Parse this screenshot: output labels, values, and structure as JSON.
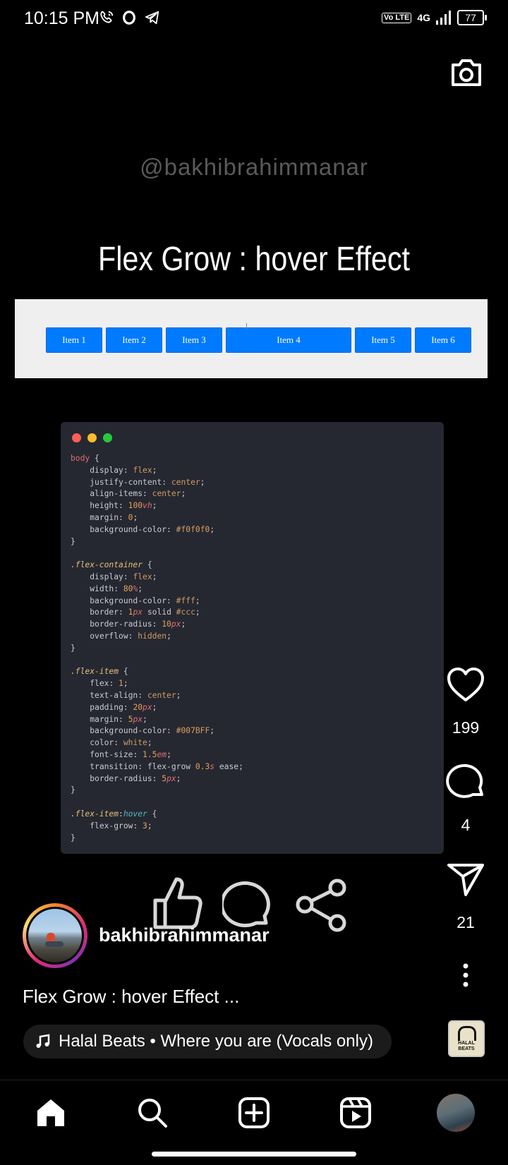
{
  "status_bar": {
    "time": "10:15 PM",
    "volte": "Vo LTE",
    "network": "4G",
    "battery": "77",
    "icons": [
      "call-icon",
      "opera-icon",
      "telegram-icon",
      "signal-icon",
      "battery-icon"
    ]
  },
  "post": {
    "watermark": "@bakhibrahimmanar",
    "title": "Flex Grow : hover Effect",
    "demo_items": [
      "Item 1",
      "Item 2",
      "Item 3",
      "Item 4",
      "Item 5",
      "Item 6"
    ],
    "code_lines": [
      "body {",
      "    display: flex;",
      "    justify-content: center;",
      "    align-items: center;",
      "    height: 100vh;",
      "    margin: 0;",
      "    background-color: #f0f0f0;",
      "}",
      "",
      ".flex-container {",
      "    display: flex;",
      "    width: 80%;",
      "    background-color: #fff;",
      "    border: 1px solid #ccc;",
      "    border-radius: 10px;",
      "    overflow: hidden;",
      "}",
      "",
      ".flex-item {",
      "    flex: 1;",
      "    text-align: center;",
      "    padding: 20px;",
      "    margin: 5px;",
      "    background-color: #007BFF;",
      "    color: white;",
      "    font-size: 1.5em;",
      "    transition: flex-grow 0.3s ease;",
      "    border-radius: 5px;",
      "}",
      "",
      ".flex-item:hover {",
      "    flex-grow: 3;",
      "}"
    ]
  },
  "actions": {
    "likes": "199",
    "comments": "4",
    "shares": "21"
  },
  "author": {
    "username": "bakhibrahimmanar",
    "caption": "Flex Grow : hover Effect ..."
  },
  "music": {
    "label": "Halal Beats • Where you are (Vocals only)",
    "thumb_text": "HALAL BEATS"
  },
  "nav": [
    "home",
    "search",
    "create",
    "reels",
    "profile"
  ],
  "colors": {
    "background": "#000000",
    "demo_item": "#007BFF",
    "code_bg": "#252830",
    "dot_red": "#ff5f57",
    "dot_yellow": "#febc2e",
    "dot_green": "#28c840"
  }
}
